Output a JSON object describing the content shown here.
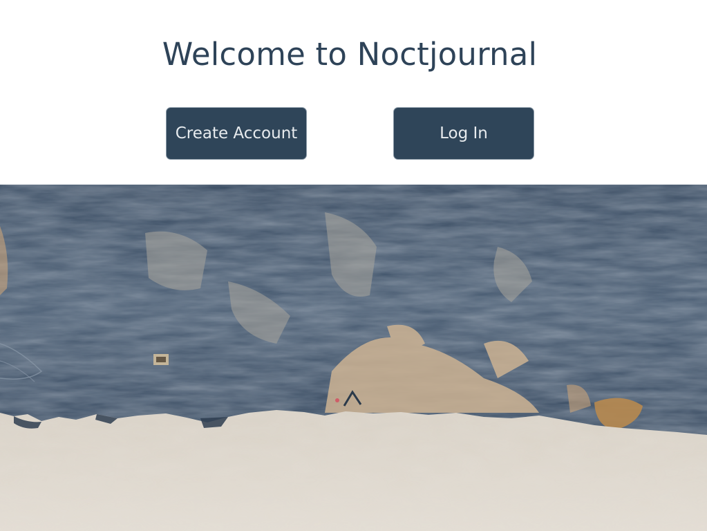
{
  "welcome": {
    "title": "Welcome to Noctjournal"
  },
  "actions": {
    "create_account_label": "Create Account",
    "log_in_label": "Log In"
  },
  "colors": {
    "title_text": "#2e4358",
    "button_bg": "#2f4559",
    "button_text": "#e7ebee",
    "wall_dark": "#34475d",
    "wall_light": "#ddd6cc"
  }
}
